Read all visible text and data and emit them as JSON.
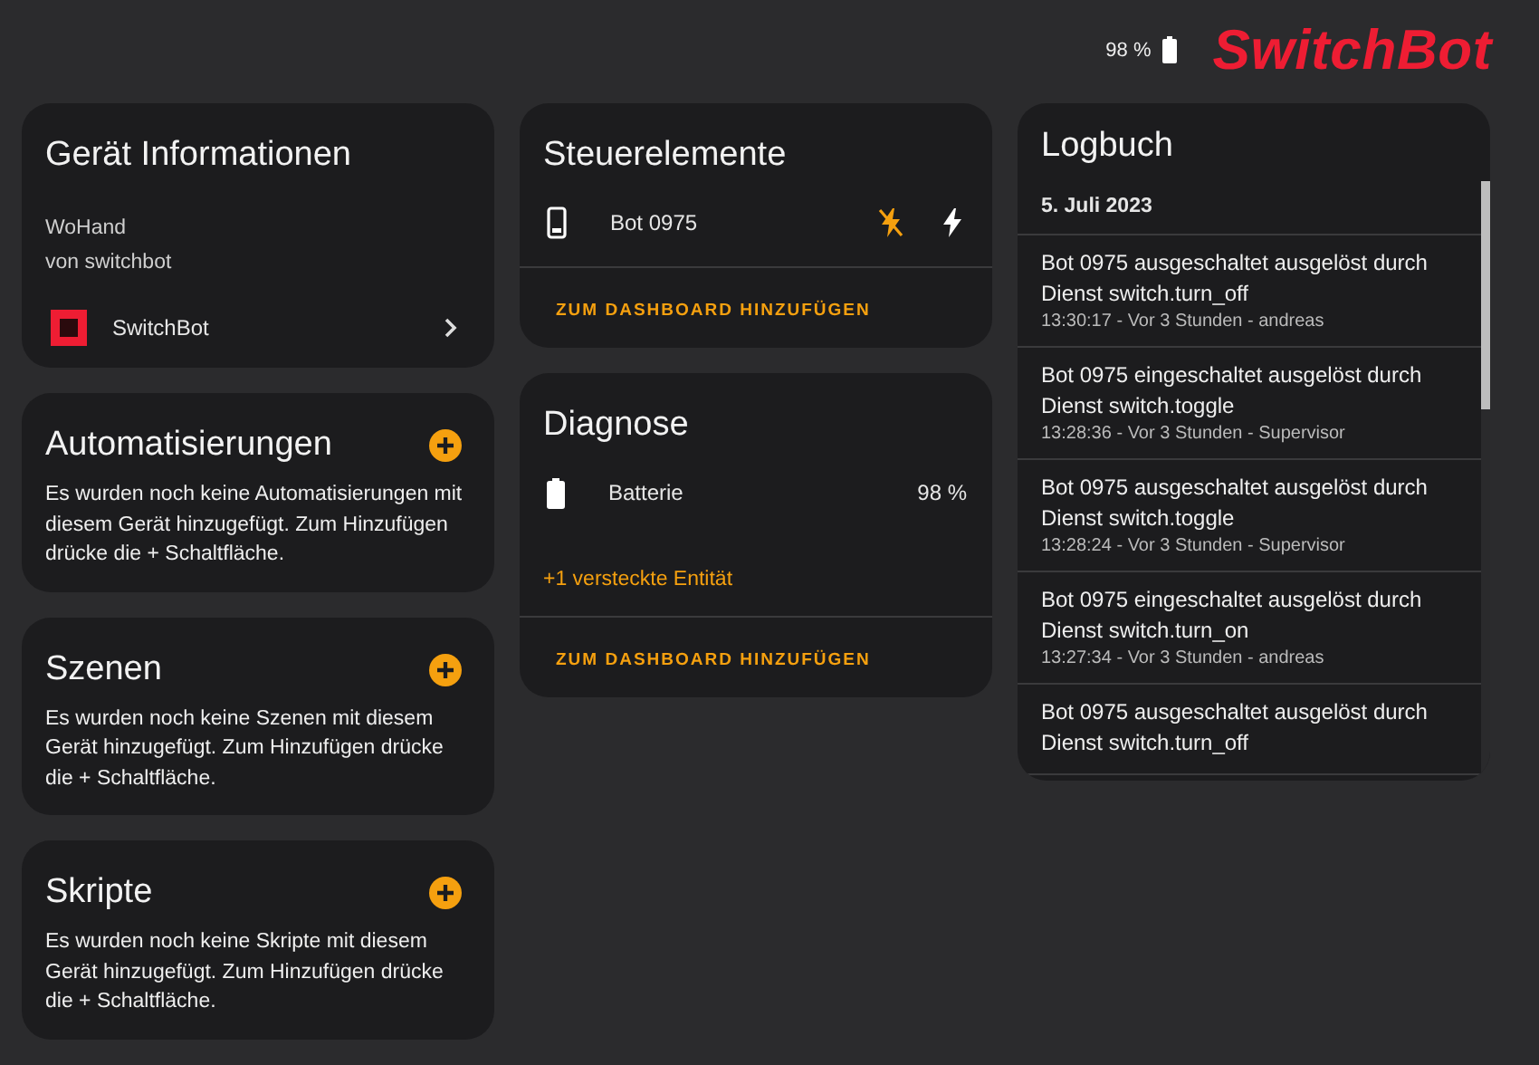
{
  "header": {
    "battery": "98 %",
    "logo": "SwitchBot"
  },
  "device_info": {
    "title": "Gerät Informationen",
    "model": "WoHand",
    "manufacturer": "von switchbot",
    "integration": "SwitchBot"
  },
  "related": [
    {
      "title": "Automatisierungen",
      "text": "Es wurden noch keine Automatisierungen mit diesem Gerät hinzugefügt. Zum Hinzufügen drücke die + Schaltfläche."
    },
    {
      "title": "Szenen",
      "text": "Es wurden noch keine Szenen mit diesem Gerät hinzugefügt. Zum Hinzufügen drücke die + Schaltfläche."
    },
    {
      "title": "Skripte",
      "text": "Es wurden noch keine Skripte mit diesem Gerät hinzugefügt. Zum Hinzufügen drücke die + Schaltfläche."
    }
  ],
  "controls": {
    "title": "Steuerelemente",
    "entity": "Bot 0975",
    "actions": [
      {
        "kind": "off",
        "active": true
      },
      {
        "kind": "on",
        "active": false
      }
    ],
    "add_button": "ZUM DASHBOARD HINZUFÜGEN"
  },
  "diagnostics": {
    "title": "Diagnose",
    "entity": "Batterie",
    "value": "98 %",
    "hidden_link": "+1 versteckte Entität",
    "add_button": "ZUM DASHBOARD HINZUFÜGEN"
  },
  "logbook": {
    "title": "Logbuch",
    "date": "5. Juli 2023",
    "entries": [
      {
        "message": "Bot 0975 ausgeschaltet ausgelöst durch Dienst switch.turn_off",
        "meta": "13:30:17 - Vor 3 Stunden - andreas"
      },
      {
        "message": "Bot 0975 eingeschaltet ausgelöst durch Dienst switch.toggle",
        "meta": "13:28:36 - Vor 3 Stunden - Supervisor"
      },
      {
        "message": "Bot 0975 ausgeschaltet ausgelöst durch Dienst switch.toggle",
        "meta": "13:28:24 - Vor 3 Stunden - Supervisor"
      },
      {
        "message": "Bot 0975 eingeschaltet ausgelöst durch Dienst switch.turn_on",
        "meta": "13:27:34 - Vor 3 Stunden - andreas"
      },
      {
        "message": "Bot 0975 ausgeschaltet ausgelöst durch Dienst switch.turn_off"
      }
    ]
  }
}
